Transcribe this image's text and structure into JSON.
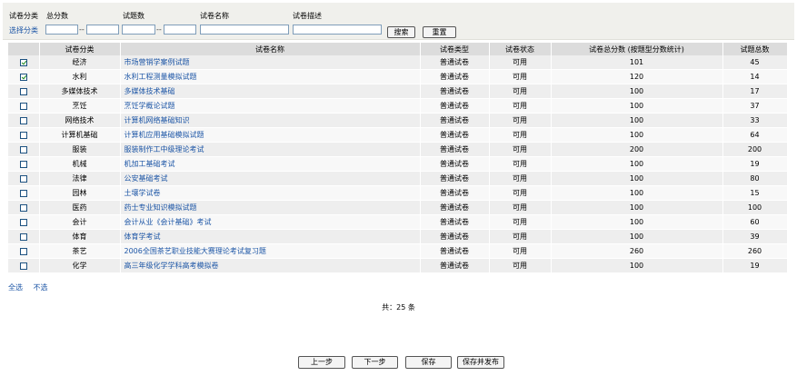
{
  "filter": {
    "category_label": "试卷分类",
    "total_score_label": "总分数",
    "question_count_label": "试题数",
    "paper_name_label": "试卷名称",
    "paper_desc_label": "试卷描述",
    "select_category_link": "选择分类",
    "range_separator": "--",
    "search_button": "搜索",
    "reset_button": "重置"
  },
  "table": {
    "headers": [
      "",
      "试卷分类",
      "试卷名称",
      "试卷类型",
      "试卷状态",
      "试卷总分数 (按题型分数统计)",
      "试题总数"
    ],
    "rows": [
      {
        "checked": true,
        "category": "经济",
        "name": "市场营销学案例试题",
        "type": "普通试卷",
        "status": "可用",
        "score": "101",
        "count": "45"
      },
      {
        "checked": true,
        "category": "水利",
        "name": "水利工程测量模拟试题",
        "type": "普通试卷",
        "status": "可用",
        "score": "120",
        "count": "14"
      },
      {
        "checked": false,
        "category": "多媒体技术",
        "name": "多媒体技术基础",
        "type": "普通试卷",
        "status": "可用",
        "score": "100",
        "count": "17"
      },
      {
        "checked": false,
        "category": "烹饪",
        "name": "烹饪学概论试题",
        "type": "普通试卷",
        "status": "可用",
        "score": "100",
        "count": "37"
      },
      {
        "checked": false,
        "category": "网络技术",
        "name": "计算机网络基础知识",
        "type": "普通试卷",
        "status": "可用",
        "score": "100",
        "count": "33"
      },
      {
        "checked": false,
        "category": "计算机基础",
        "name": "计算机应用基础模拟试题",
        "type": "普通试卷",
        "status": "可用",
        "score": "100",
        "count": "64"
      },
      {
        "checked": false,
        "category": "服装",
        "name": "服装制作工中级理论考试",
        "type": "普通试卷",
        "status": "可用",
        "score": "200",
        "count": "200"
      },
      {
        "checked": false,
        "category": "机械",
        "name": "机加工基础考试",
        "type": "普通试卷",
        "status": "可用",
        "score": "100",
        "count": "19"
      },
      {
        "checked": false,
        "category": "法律",
        "name": "公安基础考试",
        "type": "普通试卷",
        "status": "可用",
        "score": "100",
        "count": "80"
      },
      {
        "checked": false,
        "category": "园林",
        "name": "土壤学试卷",
        "type": "普通试卷",
        "status": "可用",
        "score": "100",
        "count": "15"
      },
      {
        "checked": false,
        "category": "医药",
        "name": "药士专业知识模拟试题",
        "type": "普通试卷",
        "status": "可用",
        "score": "100",
        "count": "100"
      },
      {
        "checked": false,
        "category": "会计",
        "name": "会计从业《会计基础》考试",
        "type": "普通试卷",
        "status": "可用",
        "score": "100",
        "count": "60"
      },
      {
        "checked": false,
        "category": "体育",
        "name": "体育学考试",
        "type": "普通试卷",
        "status": "可用",
        "score": "100",
        "count": "39"
      },
      {
        "checked": false,
        "category": "茶艺",
        "name": "2006全国茶艺职业技能大赛理论考试复习题",
        "type": "普通试卷",
        "status": "可用",
        "score": "260",
        "count": "260"
      },
      {
        "checked": false,
        "category": "化学",
        "name": "高三年级化学学科高考模拟卷",
        "type": "普通试卷",
        "status": "可用",
        "score": "100",
        "count": "19"
      }
    ]
  },
  "selection": {
    "select_all": "全选",
    "select_none": "不选"
  },
  "summary": {
    "total": "共：25 条"
  },
  "footer": {
    "prev": "上一步",
    "next": "下一步",
    "save": "保存",
    "save_publish": "保存并发布"
  }
}
